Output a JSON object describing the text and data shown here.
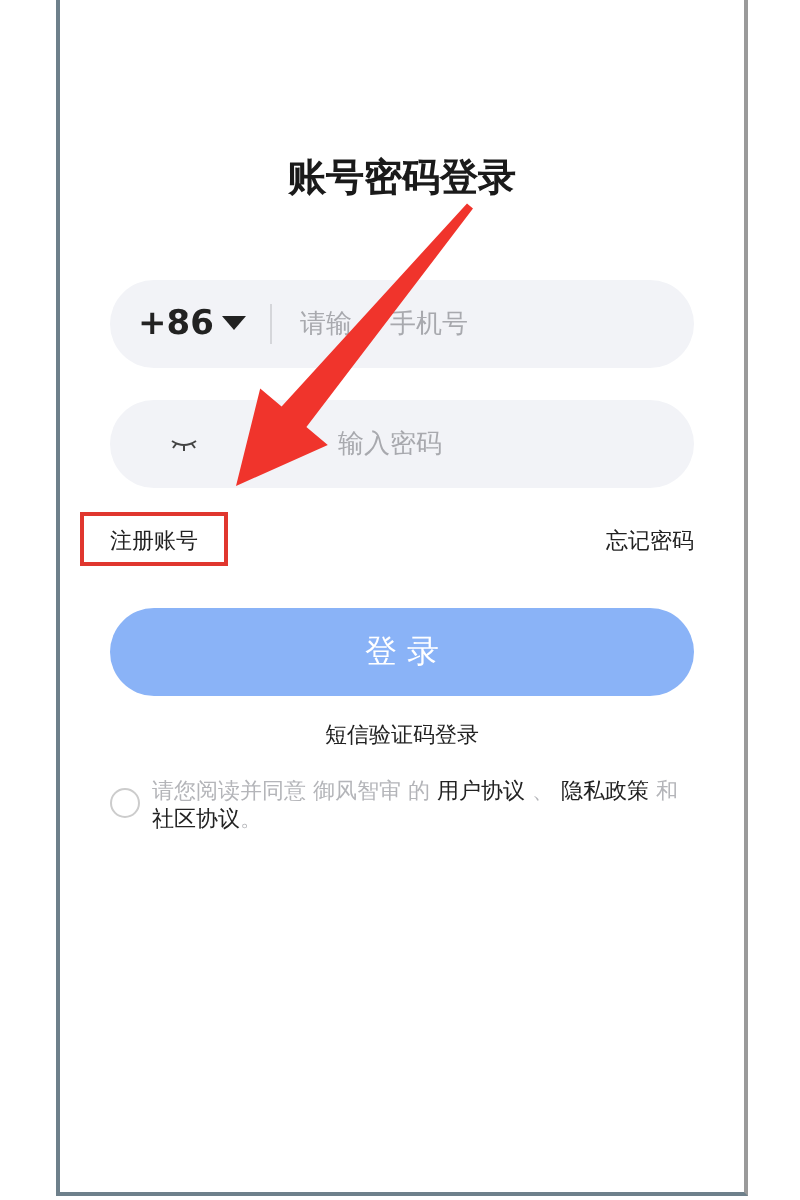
{
  "title": "账号密码登录",
  "phone_field": {
    "country_code": "+86",
    "placeholder": [
      "请输",
      "手机号"
    ]
  },
  "password_field": {
    "placeholder": "输入密码"
  },
  "register_link": {
    "label": "注册账号"
  },
  "forgot_link": {
    "label": "忘记密码"
  },
  "login_button": {
    "label": "登 录",
    "disabled": true
  },
  "sms_login_link": {
    "label": "短信验证码登录"
  },
  "agreement": {
    "checked": false,
    "parts": [
      {
        "kind": "plain",
        "text": "请您阅读并同意 御风智审 的 "
      },
      {
        "kind": "link",
        "text": "用户协议"
      },
      {
        "kind": "plain",
        "text": " 、 "
      },
      {
        "kind": "link",
        "text": "隐私政策"
      },
      {
        "kind": "plain",
        "text": " 和 "
      },
      {
        "kind": "link",
        "text": "社区协议"
      },
      {
        "kind": "plain",
        "text": "。"
      }
    ]
  }
}
